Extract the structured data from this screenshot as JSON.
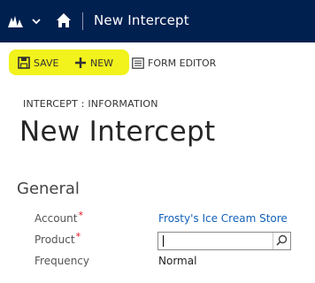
{
  "nav": {
    "title": "New Intercept",
    "brand_icon": "dynamics-logo-icon",
    "menu_icon": "chevron-down-icon",
    "home_icon": "home-icon"
  },
  "commands": {
    "save": {
      "label": "SAVE",
      "icon": "save-icon"
    },
    "new": {
      "label": "NEW",
      "icon": "plus-icon"
    },
    "form_editor": {
      "label": "FORM EDITOR",
      "icon": "form-editor-icon"
    },
    "highlight_color": "#f2f21c"
  },
  "header": {
    "breadcrumb": "INTERCEPT : INFORMATION",
    "title": "New Intercept"
  },
  "section": {
    "title": "General",
    "fields": {
      "account": {
        "label": "Account",
        "required": "*",
        "value": "Frosty's Ice Cream Store"
      },
      "product": {
        "label": "Product",
        "required": "*",
        "value": "",
        "lookup_icon": "search-icon"
      },
      "frequency": {
        "label": "Frequency",
        "value": "Normal"
      }
    }
  },
  "colors": {
    "nav_bg": "#002050",
    "link": "#1160b7",
    "required": "#e81123"
  }
}
